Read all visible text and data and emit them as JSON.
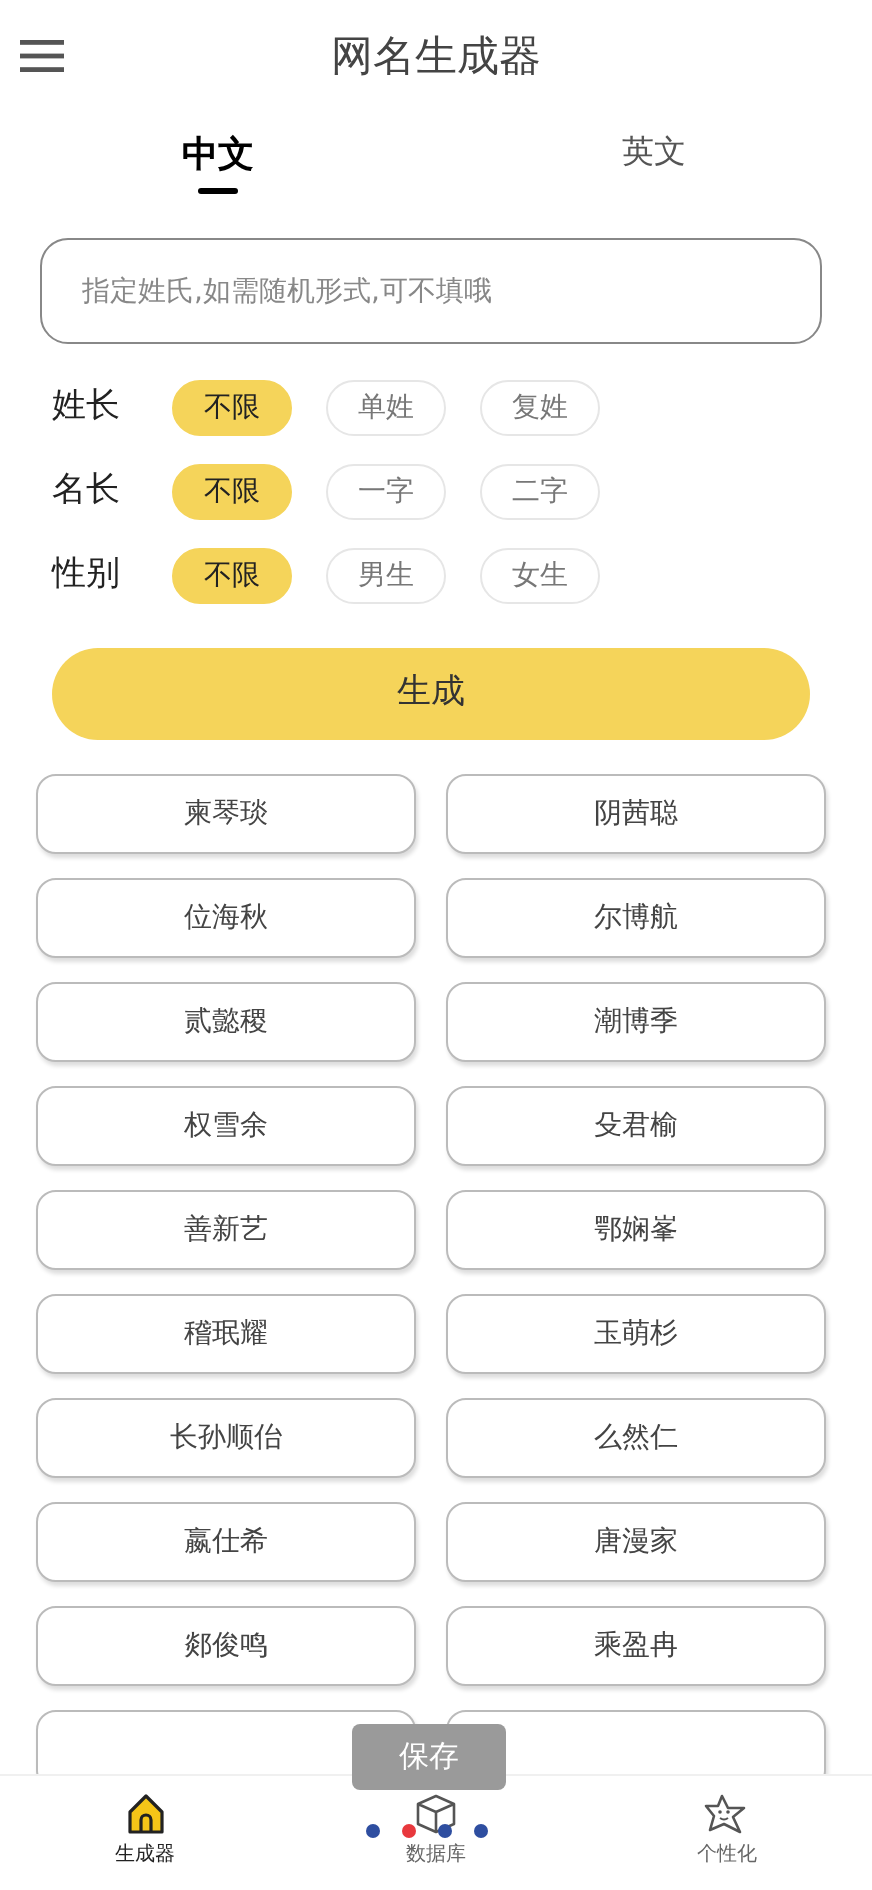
{
  "app_bar": {
    "title": "网名生成器"
  },
  "tabs": [
    {
      "label": "中文",
      "selected": true
    },
    {
      "label": "英文",
      "selected": false
    }
  ],
  "surname_field": {
    "placeholder": "指定姓氏,如需随机形式,可不填哦"
  },
  "options": [
    {
      "label": "姓长",
      "choices": [
        {
          "label": "不限",
          "selected": true
        },
        {
          "label": "单姓",
          "selected": false
        },
        {
          "label": "复姓",
          "selected": false
        }
      ]
    },
    {
      "label": "名长",
      "choices": [
        {
          "label": "不限",
          "selected": true
        },
        {
          "label": "一字",
          "selected": false
        },
        {
          "label": "二字",
          "selected": false
        }
      ]
    },
    {
      "label": "性别",
      "choices": [
        {
          "label": "不限",
          "selected": true
        },
        {
          "label": "男生",
          "selected": false
        },
        {
          "label": "女生",
          "selected": false
        }
      ]
    }
  ],
  "generate_button": "生成",
  "names": [
    {
      "kind": "name",
      "text": "柬琴琰"
    },
    {
      "kind": "name",
      "text": "阴茜聪"
    },
    {
      "kind": "name",
      "text": "位海秋"
    },
    {
      "kind": "name",
      "text": "尔博航"
    },
    {
      "kind": "name",
      "text": "贰懿稷"
    },
    {
      "kind": "name",
      "text": "潮博季"
    },
    {
      "kind": "name",
      "text": "权雪余"
    },
    {
      "kind": "name",
      "text": "殳君榆"
    },
    {
      "kind": "name",
      "text": "善新艺"
    },
    {
      "kind": "name",
      "text": "鄂娴峯"
    },
    {
      "kind": "name",
      "text": "稽珉耀"
    },
    {
      "kind": "name",
      "text": "玉萌杉"
    },
    {
      "kind": "name",
      "text": "长孙顺佁"
    },
    {
      "kind": "name",
      "text": "么然仁"
    },
    {
      "kind": "name",
      "text": "嬴仕希"
    },
    {
      "kind": "name",
      "text": "唐漫家"
    },
    {
      "kind": "name",
      "text": "郯俊鸣"
    },
    {
      "kind": "name",
      "text": "乘盈冉"
    },
    {
      "kind": "cut"
    },
    {
      "kind": "cut"
    }
  ],
  "toast": "保存",
  "pager": [
    {
      "selected": false
    },
    {
      "selected": true
    },
    {
      "selected": false
    },
    {
      "selected": false
    }
  ],
  "bottom_nav": [
    {
      "label": "生成器",
      "kind": "home",
      "selected": true
    },
    {
      "label": "数据库",
      "kind": "box",
      "selected": false
    },
    {
      "label": "个性化",
      "kind": "star",
      "selected": false
    }
  ]
}
